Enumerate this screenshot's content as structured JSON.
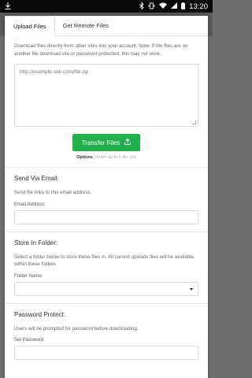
{
  "statusbar": {
    "time": "13:20",
    "icons": [
      "download-icon",
      "bluetooth-icon",
      "vibrate-icon",
      "wifi-icon",
      "signal-icon",
      "battery-icon"
    ]
  },
  "tabs": [
    {
      "label": "Upload Files",
      "active": true
    },
    {
      "label": "Get Remote Files",
      "active": false
    }
  ],
  "remote": {
    "description": "Download files directly from other sites into your account. Note: If the files are on another file download site or password protected, this may not work.",
    "url_placeholder": "http://example-site.com/file.zip",
    "transfer_label": "Transfer Files",
    "options_label": "Options",
    "options_separator": "|",
    "options_hint": "Enter up to 5 file urls"
  },
  "email_section": {
    "title": "Send Via Email:",
    "description": "Send file links to this email address.",
    "field_label": "Email Address:"
  },
  "folder_section": {
    "title": "Store In Folder:",
    "description": "Select a folder below to store these files in. All current uploads files will be available within these folders.",
    "field_label": "Folder Name:"
  },
  "password_section": {
    "title": "Password Protect:",
    "description": "Users will be prompted for password before downloading.",
    "field_label": "Set Password:"
  },
  "colors": {
    "accent": "#22b14c",
    "statusbar": "#0a0a0a",
    "overlay": "#6f6f6f"
  }
}
